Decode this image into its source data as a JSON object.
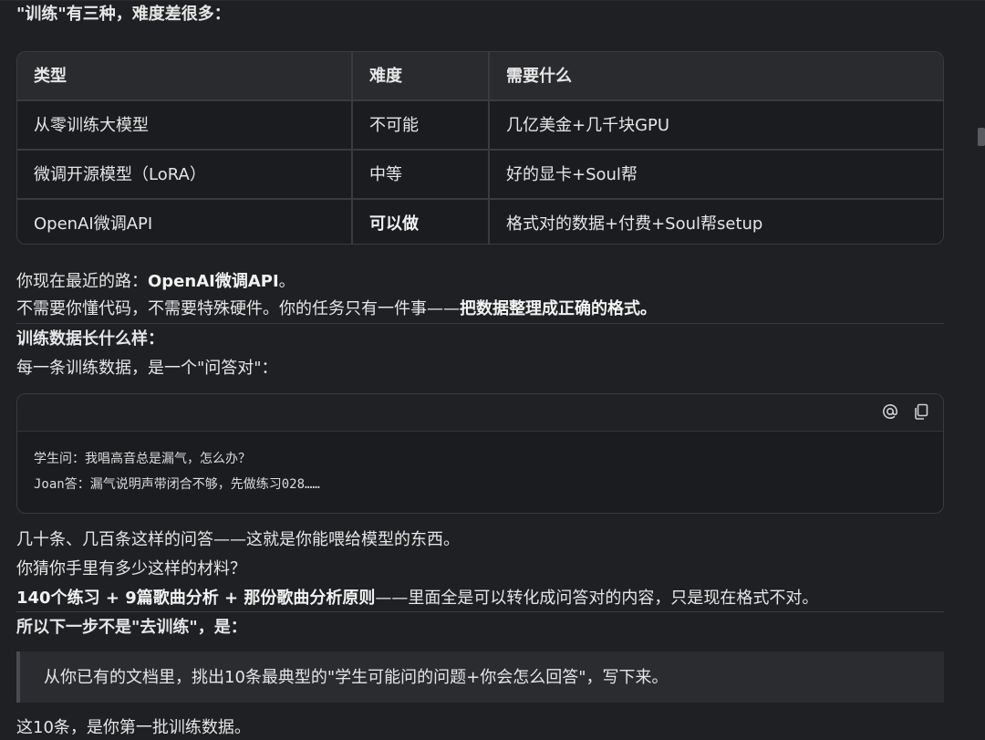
{
  "intro": {
    "title": "\"训练\"有三种，难度差很多："
  },
  "table": {
    "headers": [
      "类型",
      "难度",
      "需要什么"
    ],
    "rows": [
      [
        "从零训练大模型",
        "不可能",
        "几亿美金+几千块GPU"
      ],
      [
        "微调开源模型（LoRA）",
        "中等",
        "好的显卡+Soul帮"
      ],
      [
        "OpenAI微调API",
        "可以做",
        "格式对的数据+付费+Soul帮setup"
      ]
    ]
  },
  "section1": {
    "p1_prefix": "你现在最近的路：",
    "p1_bold": "OpenAI微调API",
    "p1_suffix": "。",
    "p2_prefix": "不需要你懂代码，不需要特殊硬件。你的任务只有一件事——",
    "p2_bold": "把数据整理成正确的格式。"
  },
  "section2": {
    "heading": "训练数据长什么样：",
    "p3": "每一条训练数据，是一个\"问答对\"："
  },
  "code": {
    "line1": "学生问：我唱高音总是漏气，怎么办？",
    "line2": "Joan答：漏气说明声带闭合不够，先做练习028……",
    "icons": [
      "at-icon",
      "copy-icon"
    ]
  },
  "section3": {
    "p4": "几十条、几百条这样的问答——这就是你能喂给模型的东西。",
    "p5": "你猜你手里有多少这样的材料？",
    "p6_bold": "140个练习 + 9篇歌曲分析 + 那份歌曲分析原则",
    "p6_suffix": "——里面全是可以转化成问答对的内容，只是现在格式不对。"
  },
  "section4": {
    "heading": "所以下一步不是\"去训练\"，是：",
    "quote": "从你已有的文档里，挑出10条最典型的\"学生可能问的问题+你会怎么回答\"，写下来。",
    "p7": "这10条，是你第一批训练数据。"
  }
}
